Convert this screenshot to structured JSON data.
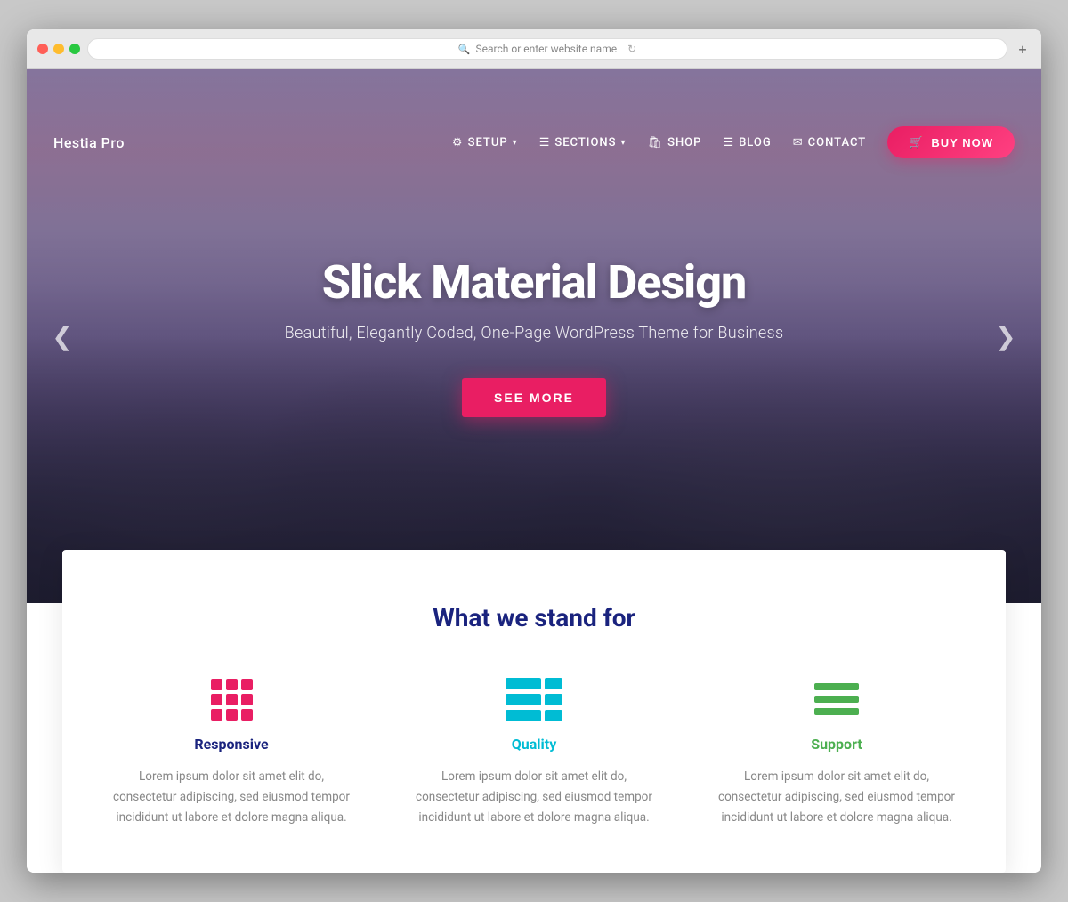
{
  "browser": {
    "address_placeholder": "Search or enter website name",
    "new_tab_label": "+"
  },
  "navbar": {
    "brand": "Hestia Pro",
    "links": [
      {
        "id": "setup",
        "label": "SETUP",
        "has_dropdown": true,
        "icon": "⚙"
      },
      {
        "id": "sections",
        "label": "SECTIONS",
        "has_dropdown": true,
        "icon": "≡"
      },
      {
        "id": "shop",
        "label": "SHOP",
        "has_dropdown": false,
        "icon": "🛍"
      },
      {
        "id": "blog",
        "label": "BLOG",
        "has_dropdown": false,
        "icon": "≡"
      },
      {
        "id": "contact",
        "label": "CONTACT",
        "has_dropdown": false,
        "icon": "✉"
      }
    ],
    "cta": {
      "label": "BUY NOW",
      "icon": "🛒"
    }
  },
  "hero": {
    "title": "Slick Material Design",
    "subtitle": "Beautiful, Elegantly Coded, One-Page WordPress Theme for Business",
    "cta_label": "SEE MORE",
    "arrow_left": "❮",
    "arrow_right": "❯"
  },
  "features": {
    "section_title": "What we stand for",
    "items": [
      {
        "id": "responsive",
        "name": "Responsive",
        "description": "Lorem ipsum dolor sit amet elit do, consectetur adipiscing, sed eiusmod tempor incididunt ut labore et dolore magna aliqua.",
        "icon_type": "grid",
        "color": "#e91e63"
      },
      {
        "id": "quality",
        "name": "Quality",
        "description": "Lorem ipsum dolor sit amet elit do, consectetur adipiscing, sed eiusmod tempor incididunt ut labore et dolore magna aliqua.",
        "icon_type": "table",
        "color": "#00bcd4"
      },
      {
        "id": "support",
        "name": "Support",
        "description": "Lorem ipsum dolor sit amet elit do, consectetur adipiscing, sed eiusmod tempor incididunt ut labore et dolore magna aliqua.",
        "icon_type": "lines",
        "color": "#4caf50"
      }
    ]
  }
}
